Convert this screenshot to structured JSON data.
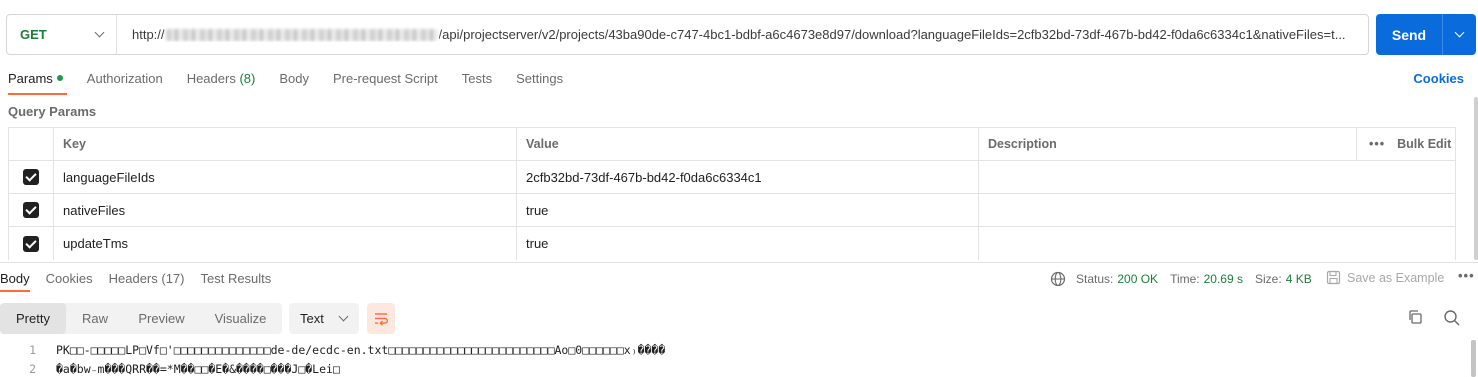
{
  "request": {
    "method": "GET",
    "url_prefix": "http://",
    "url_rest": "/api/projectserver/v2/projects/43ba90de-c747-4bc1-bdbf-a6c4673e8d97/download?languageFileIds=2cfb32bd-73df-467b-bd42-f0da6c6334c1&nativeFiles=t...",
    "send_label": "Send"
  },
  "request_tabs": [
    {
      "label": "Params",
      "active": true
    },
    {
      "label": "Authorization"
    },
    {
      "label": "Headers",
      "count": "(8)"
    },
    {
      "label": "Body"
    },
    {
      "label": "Pre-request Script"
    },
    {
      "label": "Tests"
    },
    {
      "label": "Settings"
    }
  ],
  "cookies_link": "Cookies",
  "query_params": {
    "title": "Query Params",
    "headers": {
      "key": "Key",
      "value": "Value",
      "description": "Description",
      "bulk_edit": "Bulk Edit"
    },
    "rows": [
      {
        "checked": true,
        "key": "languageFileIds",
        "value": "2cfb32bd-73df-467b-bd42-f0da6c6334c1",
        "description": ""
      },
      {
        "checked": true,
        "key": "nativeFiles",
        "value": "true",
        "description": ""
      },
      {
        "checked": true,
        "key": "updateTms",
        "value": "true",
        "description": ""
      }
    ]
  },
  "response": {
    "tabs": [
      {
        "label": "Body",
        "active": true
      },
      {
        "label": "Cookies"
      },
      {
        "label": "Headers (17)"
      },
      {
        "label": "Test Results"
      }
    ],
    "status_label": "Status:",
    "status_value": "200 OK",
    "time_label": "Time:",
    "time_value": "20.69 s",
    "size_label": "Size:",
    "size_value": "4 KB",
    "save_example": "Save as Example",
    "view_modes": [
      "Pretty",
      "Raw",
      "Preview",
      "Visualize"
    ],
    "active_view": "Pretty",
    "format": "Text",
    "body_lines": [
      {
        "n": "1",
        "text": "PK□□-□□□□□LP□Vf□'□□□□□□□□□□□□□□de-de/ecdc-en.txt□□□□□□□□□□□□□□□□□□□□□□□□Ao□0□□□□□□x₎����"
      },
      {
        "n": "2",
        "text": "�a�bw₋m���QRR��=*M��□□�E�&����□���J□�Lei□"
      }
    ]
  },
  "colors": {
    "accent": "#ff6c37",
    "primary": "#0a6bdc",
    "success": "#1a7f37"
  }
}
